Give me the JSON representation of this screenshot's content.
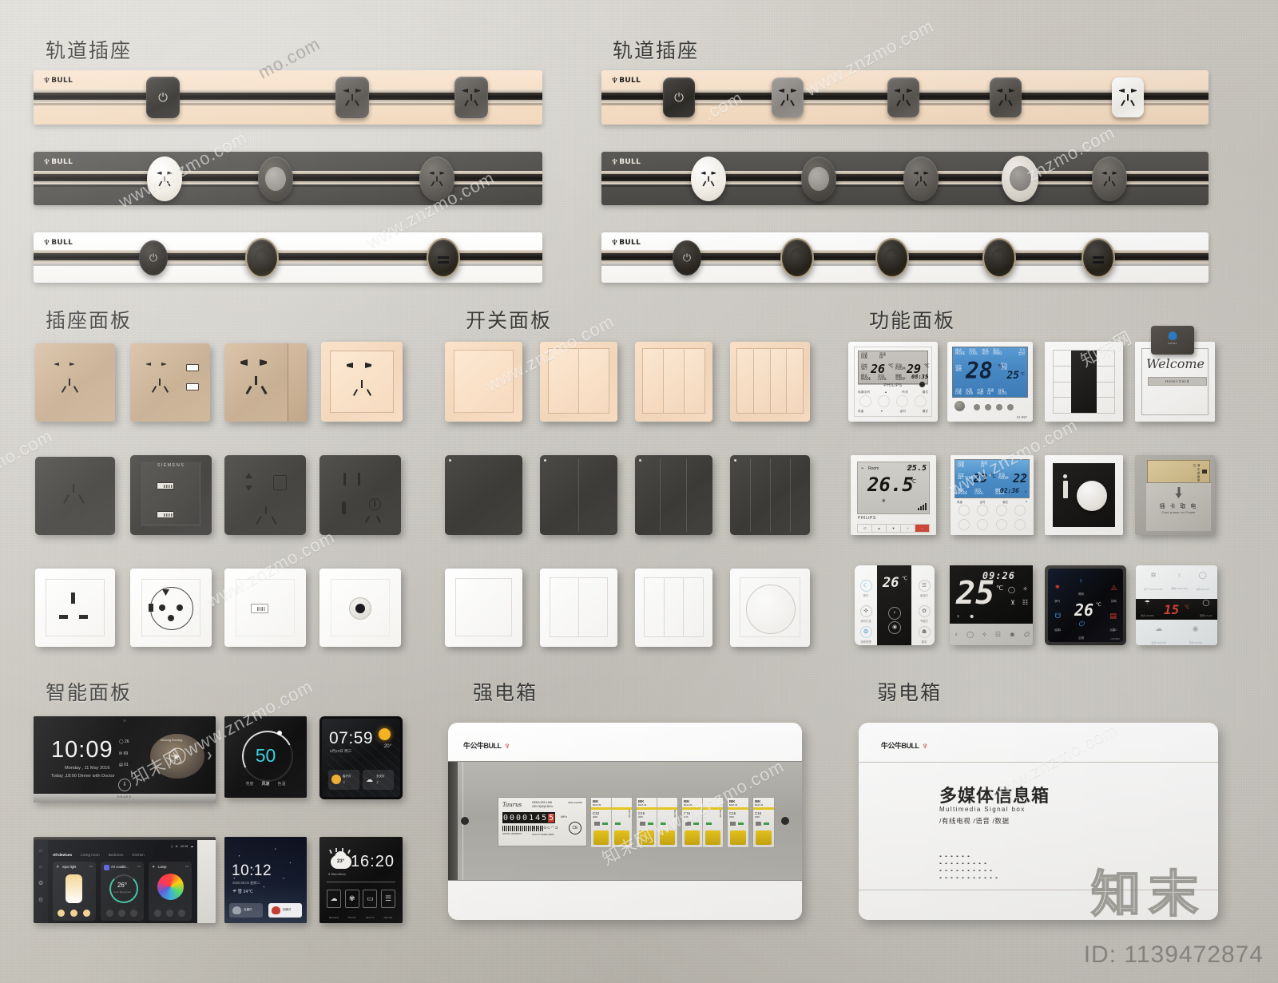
{
  "meta": {
    "id_watermark": "ID: 1139472874",
    "brand_watermark": "知末",
    "site_watermarks": [
      "www.znzmo.com",
      "知末网 www.znzmo.com",
      "znzmo.com"
    ]
  },
  "sections": [
    {
      "key": "track_socket_left",
      "title": "轨道插座"
    },
    {
      "key": "track_socket_right",
      "title": "轨道插座"
    },
    {
      "key": "socket_panel",
      "title": "插座面板"
    },
    {
      "key": "switch_panel",
      "title": "开关面板"
    },
    {
      "key": "function_panel",
      "title": "功能面板"
    },
    {
      "key": "smart_panel",
      "title": "智能面板"
    },
    {
      "key": "power_box",
      "title": "强电箱"
    },
    {
      "key": "weak_box",
      "title": "弱电箱"
    }
  ],
  "track_sockets": {
    "brand": "BULL",
    "rows": [
      {
        "id": "row1-left",
        "body_color": "#f6dfc8",
        "modules": [
          "power-button",
          "five-hole-socket",
          "five-hole-socket"
        ]
      },
      {
        "id": "row1-right",
        "body_color": "#f6dfc8",
        "modules": [
          "power-button",
          "five-hole-socket",
          "five-hole-socket",
          "five-hole-socket",
          "five-hole-socket"
        ]
      },
      {
        "id": "row2-left",
        "body_color": "#545350",
        "modules": [
          "five-hole-socket",
          "round-blank",
          "five-hole-socket"
        ]
      },
      {
        "id": "row2-right",
        "body_color": "#545350",
        "modules": [
          "five-hole-socket",
          "round-blank",
          "five-hole-socket",
          "round-blank",
          "five-hole-socket"
        ]
      },
      {
        "id": "row3-left",
        "body_color": "#fdfdfb",
        "modules": [
          "power-button",
          "round-blank",
          "usb-socket"
        ]
      },
      {
        "id": "row3-right",
        "body_color": "#fdfdfb",
        "modules": [
          "power-button",
          "round-blank",
          "round-blank",
          "round-blank",
          "usb-socket"
        ]
      }
    ]
  },
  "socket_panels": {
    "rows": [
      {
        "finish": "champagne",
        "items": [
          {
            "name": "two-pin-socket",
            "label": ""
          },
          {
            "name": "five-hole-usb-socket",
            "label": ""
          },
          {
            "name": "five-hole-socket-wide",
            "label": ""
          },
          {
            "name": "five-hole-socket-frame",
            "label": ""
          }
        ]
      },
      {
        "finish": "grey",
        "items": [
          {
            "name": "three-pin-socket",
            "label": ""
          },
          {
            "name": "dual-usb-socket",
            "label": "SIEMENS"
          },
          {
            "name": "combo-socket-network",
            "label": ""
          },
          {
            "name": "socket-tv-phone",
            "label": ""
          }
        ]
      },
      {
        "finish": "white",
        "items": [
          {
            "name": "uk-socket",
            "label": ""
          },
          {
            "name": "eu-schuko-socket",
            "label": ""
          },
          {
            "name": "usb-socket-white",
            "label": ""
          },
          {
            "name": "tv-coax-socket",
            "label": ""
          }
        ]
      }
    ]
  },
  "switch_panels": {
    "rows": [
      {
        "finish": "champagne",
        "items": [
          {
            "name": "switch-1-gang",
            "gangs": 1
          },
          {
            "name": "switch-2-gang",
            "gangs": 2
          },
          {
            "name": "switch-3-gang",
            "gangs": 3
          },
          {
            "name": "switch-4-gang",
            "gangs": 4
          }
        ]
      },
      {
        "finish": "grey",
        "items": [
          {
            "name": "switch-1-gang",
            "gangs": 1
          },
          {
            "name": "switch-2-gang",
            "gangs": 2
          },
          {
            "name": "switch-3-gang",
            "gangs": 3
          },
          {
            "name": "switch-4-gang",
            "gangs": 4
          }
        ]
      },
      {
        "finish": "white",
        "items": [
          {
            "name": "switch-1-gang",
            "gangs": 1
          },
          {
            "name": "switch-2-gang",
            "gangs": 2
          },
          {
            "name": "switch-3-gang",
            "gangs": 3
          },
          {
            "name": "dimmer-knob",
            "gangs": 0
          }
        ]
      }
    ]
  },
  "function_panels": {
    "row1": [
      {
        "name": "philips-thermostat-white",
        "brand": "PHILIPS",
        "display": {
          "top_left_label": "风速\nFAN",
          "top_right_label": "高速\nHI",
          "set_temp": "26",
          "set_unit": "℃",
          "room_temp": "29",
          "room_unit": "℃",
          "mode_label": "模式\nMODE",
          "mode_value": "冷风\nCOOL",
          "timer_label": "睡眠\nSLEEP",
          "timer_value": "08:35",
          "timer_unit": "h"
        },
        "buttons_top": [
          "电源/定时",
          "▲",
          "开/关",
          "模式"
        ],
        "buttons_bottom": [
          "风速",
          "▼",
          "定时",
          "模式"
        ]
      },
      {
        "name": "blue-lcd-thermostat",
        "model": "CI-INT",
        "display": {
          "head": [
            {
              "cn": "模式",
              "en": "MODE"
            },
            {
              "cn": "冷风",
              "en": "COOL"
            },
            {
              "cn": "热风",
              "en": "HOT"
            },
            {
              "cn": "高风",
              "en": "WIND"
            }
          ],
          "head_right": {
            "cn": "5 h",
            "en": "定时"
          },
          "set_temp": "28",
          "set_unit": "℃",
          "room_temp": "25",
          "room_unit": "℃",
          "room_label": "室内温度",
          "left_labels": [
            "设定温度",
            "室内温度"
          ],
          "bottom": [
            {
              "cn": "风速",
              "en": "FAN"
            },
            {
              "cn": "低速",
              "en": "LOW"
            },
            {
              "cn": "中速",
              "en": "MID"
            },
            {
              "cn": "高速",
              "en": "HI"
            },
            {
              "cn": "自动",
              "en": "AUTO"
            }
          ]
        }
      },
      {
        "name": "multi-gang-black-strip-panel"
      },
      {
        "name": "hotel-card-holder-welcome",
        "title": "Welcome",
        "slot_label": "Hotel-Card"
      }
    ],
    "row2": [
      {
        "name": "philips-room-thermostat",
        "brand": "PHILIPS",
        "display": {
          "wifi": true,
          "room_label": "Room",
          "set_label": "SET",
          "set_temp": "25.5",
          "big_temp": "26.5",
          "unit": "℃"
        },
        "buttons": [
          "⏻",
          "▲",
          "▼",
          "+",
          "−"
        ]
      },
      {
        "name": "blue-lcd-thermostat-2",
        "display": {
          "top_left": {
            "cn": "风速",
            "en": "FAN"
          },
          "top_right": {
            "cn": "高速",
            "en": "HI"
          },
          "set_label": {
            "cn": "设定",
            "en": "SET TEMP"
          },
          "set_temp": "23",
          "set_unit": "℃",
          "room_label": {
            "cn": "室温",
            "en": "ROOM"
          },
          "room_temp": "22",
          "room_unit": "℃",
          "mode_label": {
            "cn": "模式",
            "en": "MODE"
          },
          "mode_value": {
            "cn": "冷风",
            "en": "COOL"
          },
          "timer_label": {
            "cn": "睡眠",
            "en": "SLEEP"
          },
          "timer_value": "02:36",
          "timer_unit": "h"
        },
        "buttons": [
          "风速",
          "定时",
          "模式",
          "●",
          "电源",
          "定时",
          "模式"
        ]
      },
      {
        "name": "black-dimmer-knob-panel"
      },
      {
        "name": "card-power-slot-panel",
        "cn": "插 卡 取 电",
        "en": "Card power on Power"
      }
    ],
    "row3": [
      {
        "name": "hotel-touch-panel-white",
        "temp": "26",
        "unit": "℃",
        "keys": [
          "夜灯",
          "请勿打扰",
          "请即清理",
          "阅读灯",
          "节能灯",
          "服务"
        ]
      },
      {
        "name": "hotel-touch-panel-black",
        "clock": "09:26",
        "temp": "25",
        "unit": "℃",
        "bottom_icons": [
          "bulb-icon",
          "circle-icon",
          "fan-icon",
          "grid-icon",
          "service-icon",
          "power-icon"
        ]
      },
      {
        "name": "smart-thermostat-black",
        "temp": "26",
        "unit": "℃",
        "brand": "ORVIBO",
        "keys": [
          "换气",
          "照明",
          "排风",
          "浴霸1",
          "空调",
          "浴霸2"
        ]
      },
      {
        "name": "bathroom-master-panel",
        "temp": "15",
        "unit": "℃",
        "keys": [
          "换气 VENTILATE",
          "照明 LIGHTING",
          "排风 BLOW",
          "吹风 WARM",
          "照明 LIGHT",
          "浴霸 HEATER",
          "风暖 WARM"
        ]
      }
    ]
  },
  "smart_panels": {
    "row1": [
      {
        "name": "door-station-display",
        "time": "10:09",
        "date": "Monday , 11 May 2016",
        "event": "Today ,18:00  Dinner with Doctor",
        "stats": [
          {
            "icon": "clock-icon",
            "value": "26"
          },
          {
            "icon": "mail-icon",
            "value": "69"
          },
          {
            "icon": "file-icon",
            "value": "01"
          }
        ],
        "media_title": "Morning Running"
      },
      {
        "name": "dial-control-panel",
        "value": "50",
        "labels": [
          "亮度",
          "风速",
          "色温"
        ]
      },
      {
        "name": "weather-clock-panel",
        "time": "07:59",
        "date": "8月23日 周三",
        "temp": "20°",
        "shortcuts": [
          {
            "label": "客厅灯",
            "sub": "关"
          },
          {
            "label": "玄关灯",
            "sub": "关"
          }
        ]
      }
    ],
    "row2": [
      {
        "name": "smart-home-dashboard",
        "status_time": "10:15",
        "tabs": [
          "All devices",
          "Living room",
          "Bedroom",
          "Kitchen"
        ],
        "cards": [
          {
            "title": "Spot light",
            "type": "brightness-slider"
          },
          {
            "title": "Air conditi...",
            "type": "temperature-dial",
            "value": "26°",
            "sub": "Cool, Strong cool"
          },
          {
            "title": "Lamp",
            "type": "color-wheel"
          }
        ]
      },
      {
        "name": "night-sky-clock-panel",
        "time": "10:12",
        "date": "2020.06.02 星期二",
        "weather": "雪  24℃",
        "buttons": [
          {
            "label": "全屋灯",
            "state": "off"
          },
          {
            "label": "回家灯",
            "state": "on"
          }
        ]
      },
      {
        "name": "weather-scene-panel",
        "time": "16:20",
        "temp": "23°",
        "city": "ShenZhen",
        "scenes": [
          "Next Spot",
          "Next Air",
          "Next TV",
          "Next Set"
        ]
      }
    ]
  },
  "power_box": {
    "brand_cn": "牛公牛BULL",
    "meter": {
      "brand": "Taurus",
      "model": "HEБA 533-15Ш",
      "spec": "220V  5(60)A  50Hz",
      "pulse": "3200 imp/kWh",
      "reading": "0000145",
      "reading_highlight": "5",
      "unit": "kW·h",
      "standard": "ГОСТ Р 52322-2005"
    },
    "breakers": [
      {
        "brand": "IEK",
        "model": "BA47-29",
        "rating": "C32",
        "voltage": "400V"
      },
      {
        "brand": "IEK",
        "model": "BA47-29",
        "rating": "C16",
        "voltage": "400V"
      },
      {
        "brand": "IEK",
        "model": "BA47-29",
        "rating": "C16",
        "voltage": "400V"
      },
      {
        "brand": "IEK",
        "model": "BA47-29",
        "rating": "C16",
        "voltage": "400V"
      },
      {
        "brand": "IEK",
        "model": "BA47-29",
        "rating": "C16",
        "voltage": "400V"
      }
    ]
  },
  "weak_box": {
    "brand_cn": "牛公牛BULL",
    "title_cn": "多媒体信息箱",
    "title_en": "Multimedia Signal box",
    "subtitle": "/有线电视  /语音  /数据"
  }
}
